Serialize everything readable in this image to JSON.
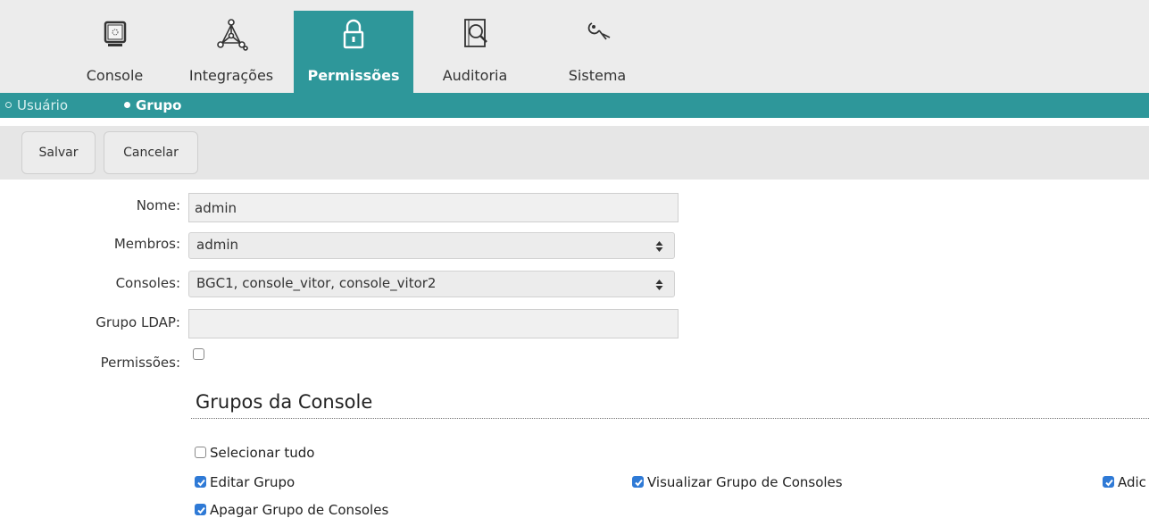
{
  "tabs": [
    {
      "label": "Console",
      "icon": "monitor-icon"
    },
    {
      "label": "Integrações",
      "icon": "network-icon"
    },
    {
      "label": "Permissões",
      "icon": "lock-icon"
    },
    {
      "label": "Auditoria",
      "icon": "document-search-icon"
    },
    {
      "label": "Sistema",
      "icon": "wrench-icon"
    }
  ],
  "subnav": {
    "items": [
      {
        "label": "Usuário"
      },
      {
        "label": "Grupo"
      }
    ]
  },
  "toolbar": {
    "save_label": "Salvar",
    "cancel_label": "Cancelar"
  },
  "form": {
    "nome": {
      "label": "Nome:",
      "value": "admin"
    },
    "membros": {
      "label": "Membros:",
      "value": "admin"
    },
    "consoles": {
      "label": "Consoles:",
      "value": "BGC1, console_vitor, console_vitor2"
    },
    "grupo_ldap": {
      "label": "Grupo LDAP:",
      "value": ""
    },
    "permissoes": {
      "label": "Permissões:",
      "checked": false
    }
  },
  "section": {
    "title": "Grupos da Console",
    "select_all": {
      "label": "Selecionar tudo",
      "checked": false
    },
    "permissions": [
      {
        "label": "Editar Grupo",
        "checked": true
      },
      {
        "label": "Visualizar Grupo de Consoles",
        "checked": true
      },
      {
        "label": "Adic",
        "checked": true
      },
      {
        "label": "Apagar Grupo de Consoles",
        "checked": true
      }
    ]
  },
  "colors": {
    "accent": "#2e979a",
    "topbar_bg": "#ececec",
    "checkbox_checked": "#2f7ad6"
  }
}
